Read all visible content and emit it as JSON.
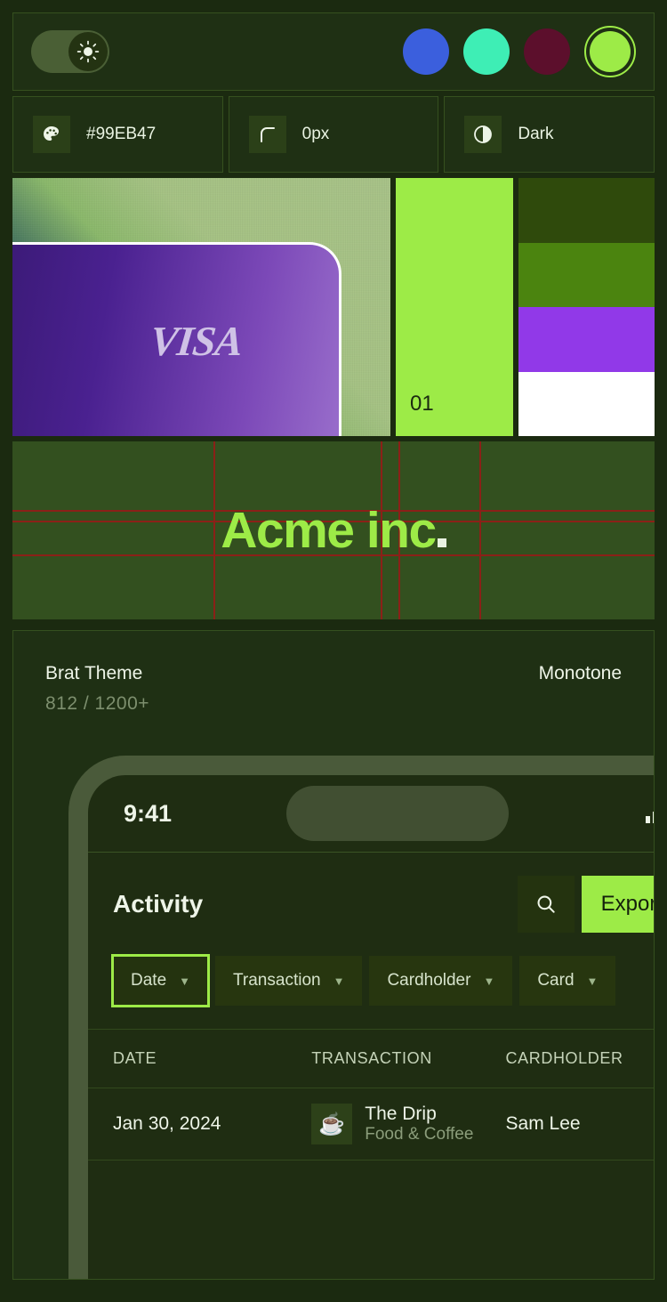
{
  "topbar": {
    "theme_toggle": {
      "name": "light-dark-toggle",
      "state": "on",
      "icon": "sun-icon"
    },
    "swatches": [
      {
        "name": "blue",
        "color": "#3b5fdd",
        "selected": false
      },
      {
        "name": "mint",
        "color": "#3eeeb5",
        "selected": false
      },
      {
        "name": "maroon",
        "color": "#5c0f2c",
        "selected": false
      },
      {
        "name": "lime",
        "color": "#9deb47",
        "selected": true
      }
    ]
  },
  "tokens": [
    {
      "icon": "palette-icon",
      "label": "#99EB47"
    },
    {
      "icon": "corner-radius-icon",
      "label": "0px"
    },
    {
      "icon": "contrast-icon",
      "label": "Dark"
    }
  ],
  "preview": {
    "card": {
      "brand": "VISA"
    },
    "swatch_tall": {
      "number": "01",
      "color": "#9deb47"
    },
    "swatch_stack": [
      {
        "name": "dark-green",
        "color": "#2f4a0c"
      },
      {
        "name": "mid-green",
        "color": "#4b840f"
      },
      {
        "name": "purple",
        "color": "#9139e8"
      },
      {
        "name": "white",
        "color": "#ffffff"
      }
    ]
  },
  "logo": {
    "text": "Acme inc",
    "dot": ".",
    "color": "#9deb47",
    "grid_color": "#8b2018"
  },
  "theme": {
    "name": "Brat Theme",
    "count": "812 / 1200+",
    "tag": "Monotone"
  },
  "phone": {
    "statusbar": {
      "time": "9:41",
      "signal_icon": "signal-bars-icon"
    },
    "activity": {
      "title": "Activity",
      "search_icon": "search-icon",
      "export_label": "Export"
    },
    "filters": [
      {
        "label": "Date",
        "active": true
      },
      {
        "label": "Transaction",
        "active": false
      },
      {
        "label": "Cardholder",
        "active": false
      },
      {
        "label": "Card",
        "active": false
      }
    ],
    "table": {
      "headers": [
        "DATE",
        "TRANSACTION",
        "CARDHOLDER"
      ],
      "rows": [
        {
          "date": "Jan 30, 2024",
          "merchant_icon": "coffee-cup-icon",
          "merchant": "The Drip",
          "category": "Food & Coffee",
          "cardholder": "Sam Lee"
        }
      ]
    }
  }
}
